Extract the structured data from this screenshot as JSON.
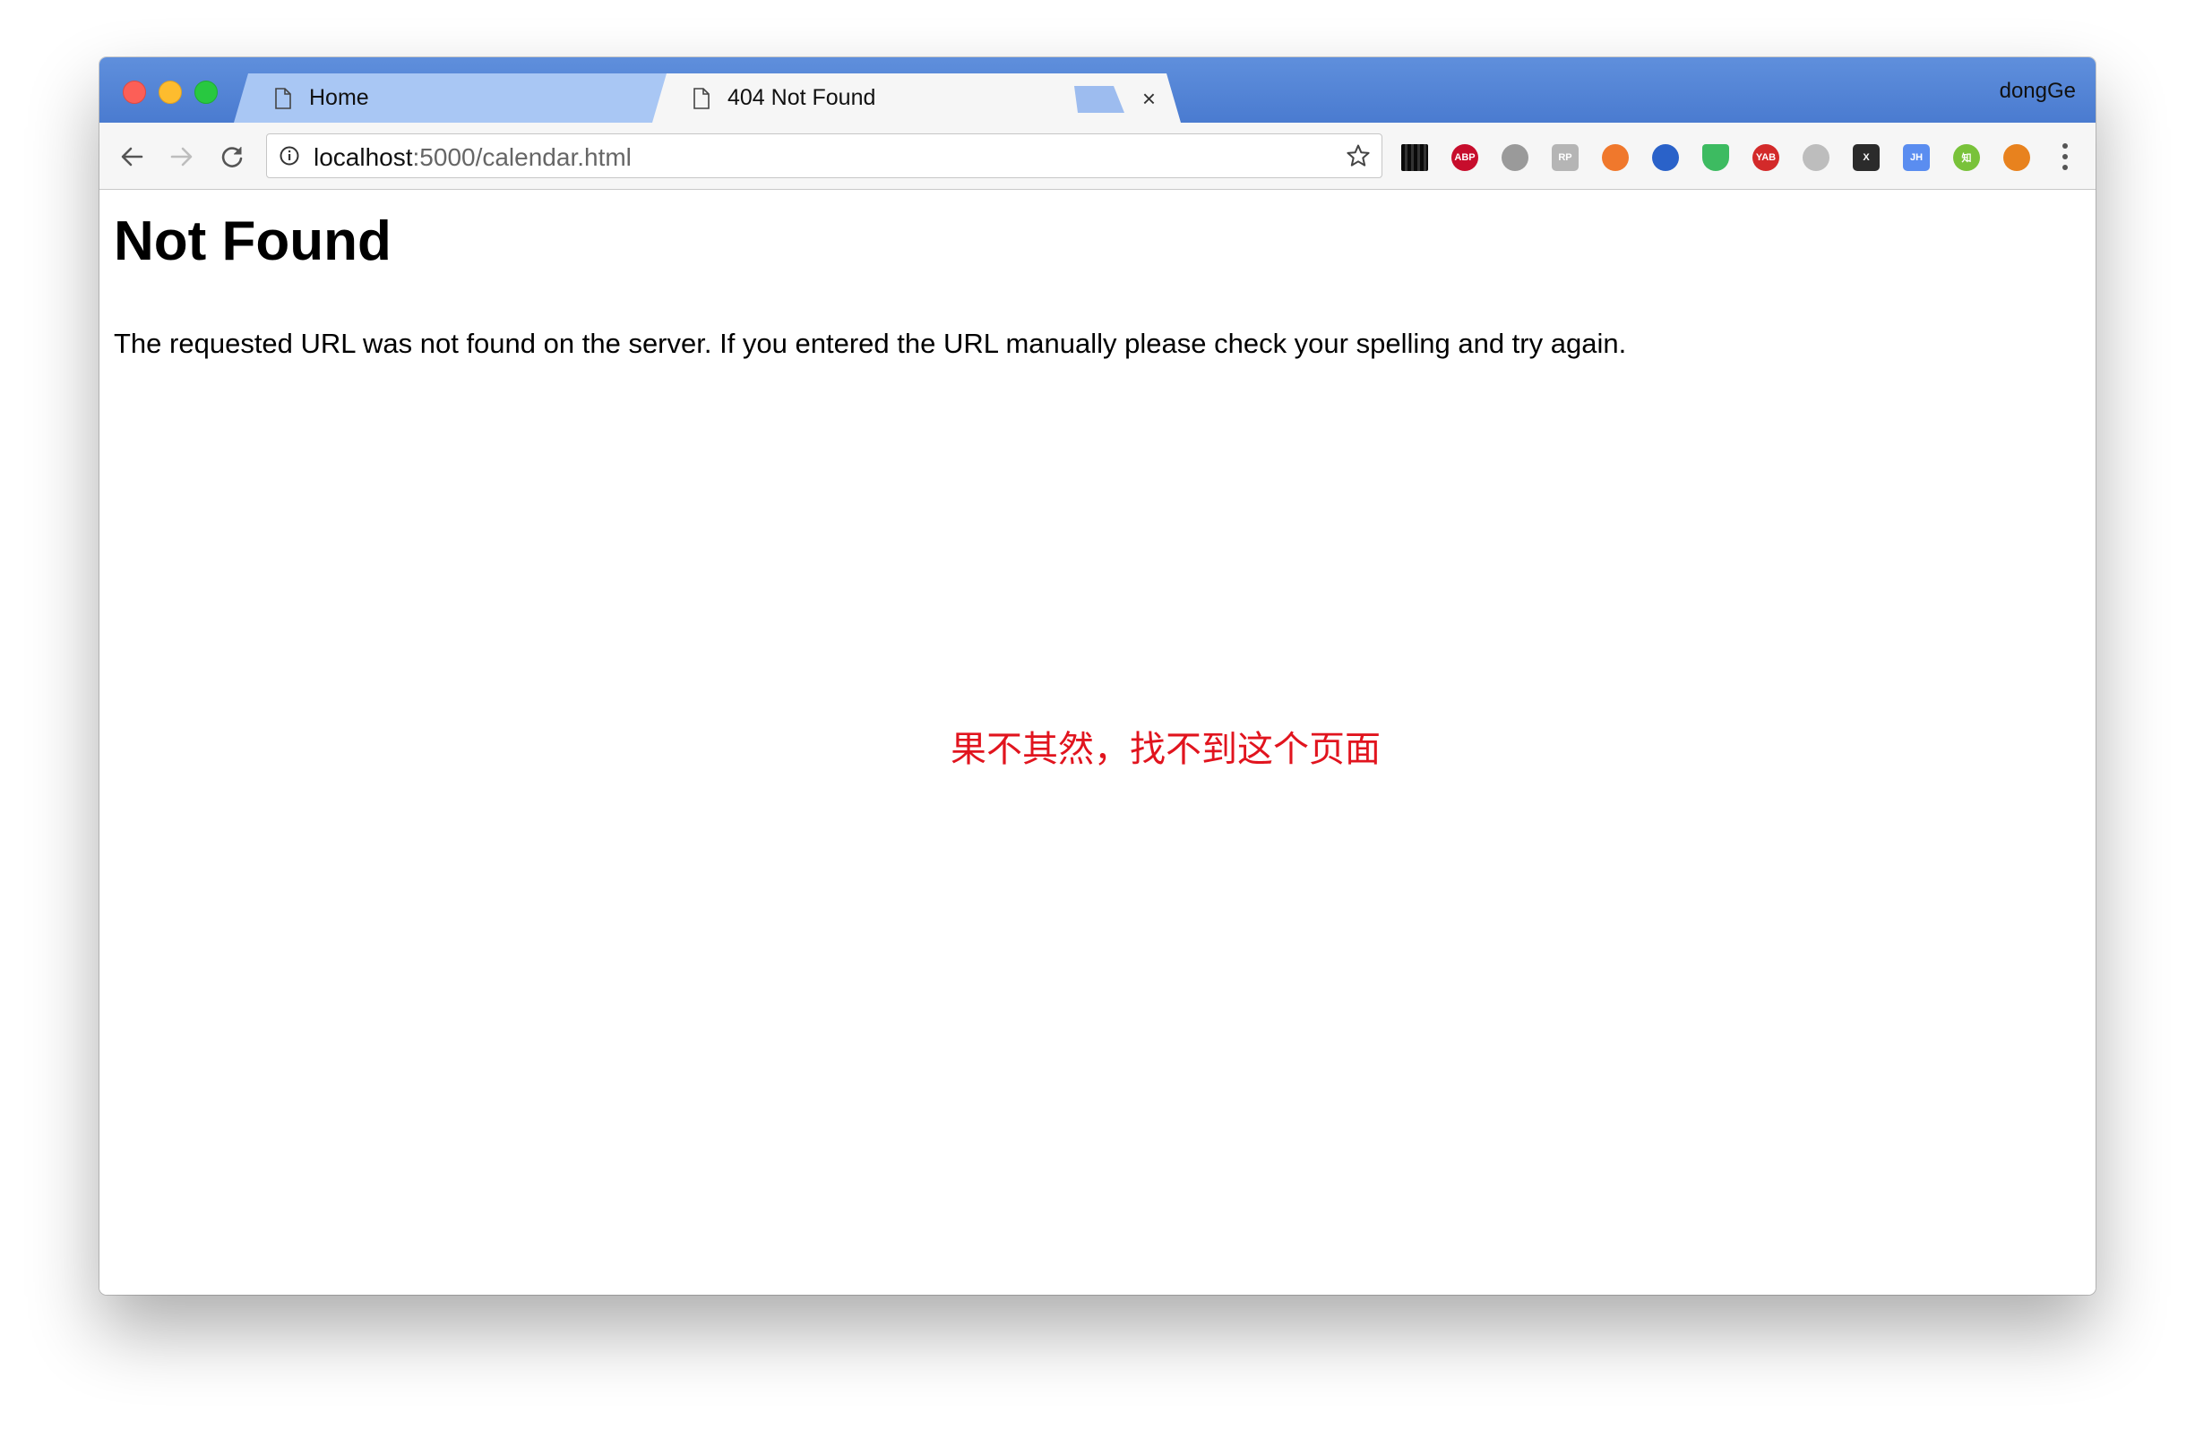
{
  "window": {
    "profile_name": "dongGe"
  },
  "tabs": [
    {
      "label": "Home",
      "icon": "document-icon",
      "close": "×",
      "active": false
    },
    {
      "label": "404 Not Found",
      "icon": "document-icon",
      "close": "×",
      "active": true
    }
  ],
  "toolbar": {
    "url_host": "localhost",
    "url_rest": ":5000/calendar.html"
  },
  "extensions": [
    {
      "name": "qr-code-icon",
      "color": "#333333",
      "text": ""
    },
    {
      "name": "adblock-plus-icon",
      "color": "#c70d2c",
      "text": "ABP"
    },
    {
      "name": "globe-icon",
      "color": "#9a9a9a",
      "text": ""
    },
    {
      "name": "rp-icon",
      "color": "#b5b5b5",
      "text": "RP"
    },
    {
      "name": "lifebuoy-icon",
      "color": "#f0782c",
      "text": ""
    },
    {
      "name": "search-translate-icon",
      "color": "#2a62c9",
      "text": ""
    },
    {
      "name": "shield-check-icon",
      "color": "#3dbb61",
      "text": ""
    },
    {
      "name": "yab-icon",
      "color": "#d32a2a",
      "text": "YAB"
    },
    {
      "name": "gray-ball-icon",
      "color": "#bdbdbd",
      "text": ""
    },
    {
      "name": "x-icon",
      "color": "#2b2b2b",
      "text": "X"
    },
    {
      "name": "jh-icon",
      "color": "#5a8df0",
      "text": "JH"
    },
    {
      "name": "zhihu-icon",
      "color": "#79c23a",
      "text": "知"
    },
    {
      "name": "fox-icon",
      "color": "#e8821e",
      "text": ""
    }
  ],
  "page": {
    "heading": "Not Found",
    "message": "The requested URL was not found on the server. If you entered the URL manually please check your spelling and try again.",
    "note": "果不其然，找不到这个页面",
    "note_color": "#e1141e"
  }
}
